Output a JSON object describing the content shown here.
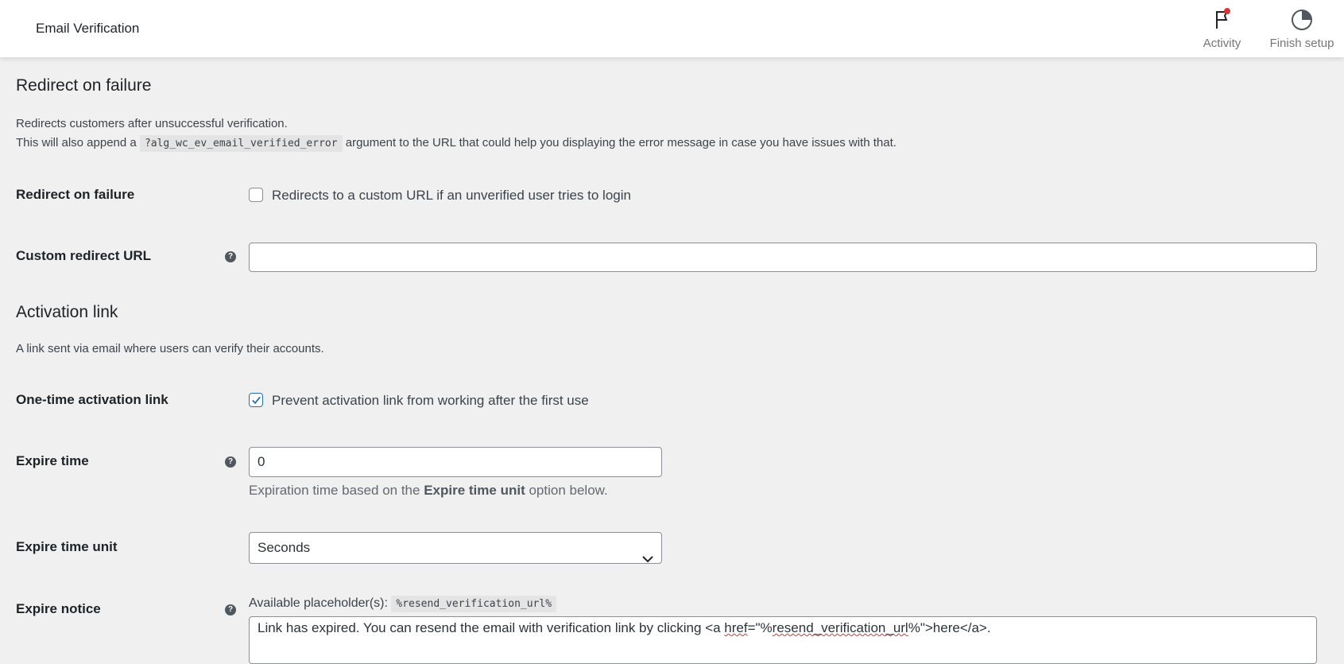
{
  "topbar": {
    "title": "Email Verification",
    "activity_label": "Activity",
    "finish_label": "Finish setup"
  },
  "redirect_section": {
    "heading": "Redirect on failure",
    "desc_line1": "Redirects customers after unsuccessful verification.",
    "desc_line2_prefix": "This will also append a",
    "desc_code": "?alg_wc_ev_email_verified_error",
    "desc_line2_suffix": "argument to the URL that could help you displaying the error message in case you have issues with that.",
    "redirect_label": "Redirect on failure",
    "redirect_checkbox_label": "Redirects to a custom URL if an unverified user tries to login",
    "redirect_checked": false,
    "custom_url_label": "Custom redirect URL",
    "custom_url_value": ""
  },
  "activation_section": {
    "heading": "Activation link",
    "desc": "A link sent via email where users can verify their accounts.",
    "one_time_label": "One-time activation link",
    "one_time_checkbox_label": "Prevent activation link from working after the first use",
    "one_time_checked": true,
    "expire_time_label": "Expire time",
    "expire_time_value": "0",
    "expire_time_desc_prefix": "Expiration time based on the",
    "expire_time_desc_bold": "Expire time unit",
    "expire_time_desc_suffix": "option below.",
    "expire_unit_label": "Expire time unit",
    "expire_unit_value": "Seconds",
    "expire_notice_label": "Expire notice",
    "placeholders_label": "Available placeholder(s):",
    "placeholder_code": "%resend_verification_url%",
    "notice_text_1": "Link has expired. You can resend the email with verification link by clicking <a ",
    "notice_text_href": "href",
    "notice_text_2": "=\"%",
    "notice_text_url": "resend_verification_url",
    "notice_text_3": "%\">here</a>."
  },
  "colors": {
    "checkbox_accent": "#2271b1",
    "help_icon": "#50575e"
  },
  "icons": {
    "activity": "flag-icon",
    "finish": "progress-circle-icon",
    "help": "question-icon",
    "select": "chevron-down-icon"
  }
}
